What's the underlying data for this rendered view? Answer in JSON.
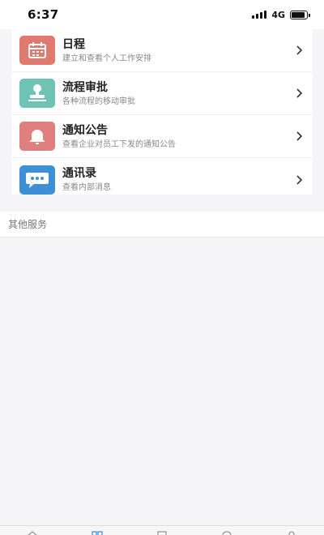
{
  "status_bar": {
    "time": "6:37",
    "network": "4G",
    "battery_level": 0.9
  },
  "menu": {
    "items": [
      {
        "title": "日程",
        "subtitle": "建立和查看个人工作安排",
        "icon": "calendar-icon",
        "color": "#e07a6e"
      },
      {
        "title": "流程审批",
        "subtitle": "各种流程的移动审批",
        "icon": "stamp-icon",
        "color": "#6fc3b5"
      },
      {
        "title": "通知公告",
        "subtitle": "查看企业对员工下发的通知公告",
        "icon": "bell-icon",
        "color": "#e07f80"
      },
      {
        "title": "通讯录",
        "subtitle": "查看内部消息",
        "icon": "chat-bubble-icon",
        "color": "#3f8fd6"
      }
    ]
  },
  "other_services": {
    "label": "其他服务"
  },
  "tabbar": {
    "icons": [
      "home-icon",
      "apps-icon",
      "document-icon",
      "message-icon",
      "user-icon"
    ]
  }
}
